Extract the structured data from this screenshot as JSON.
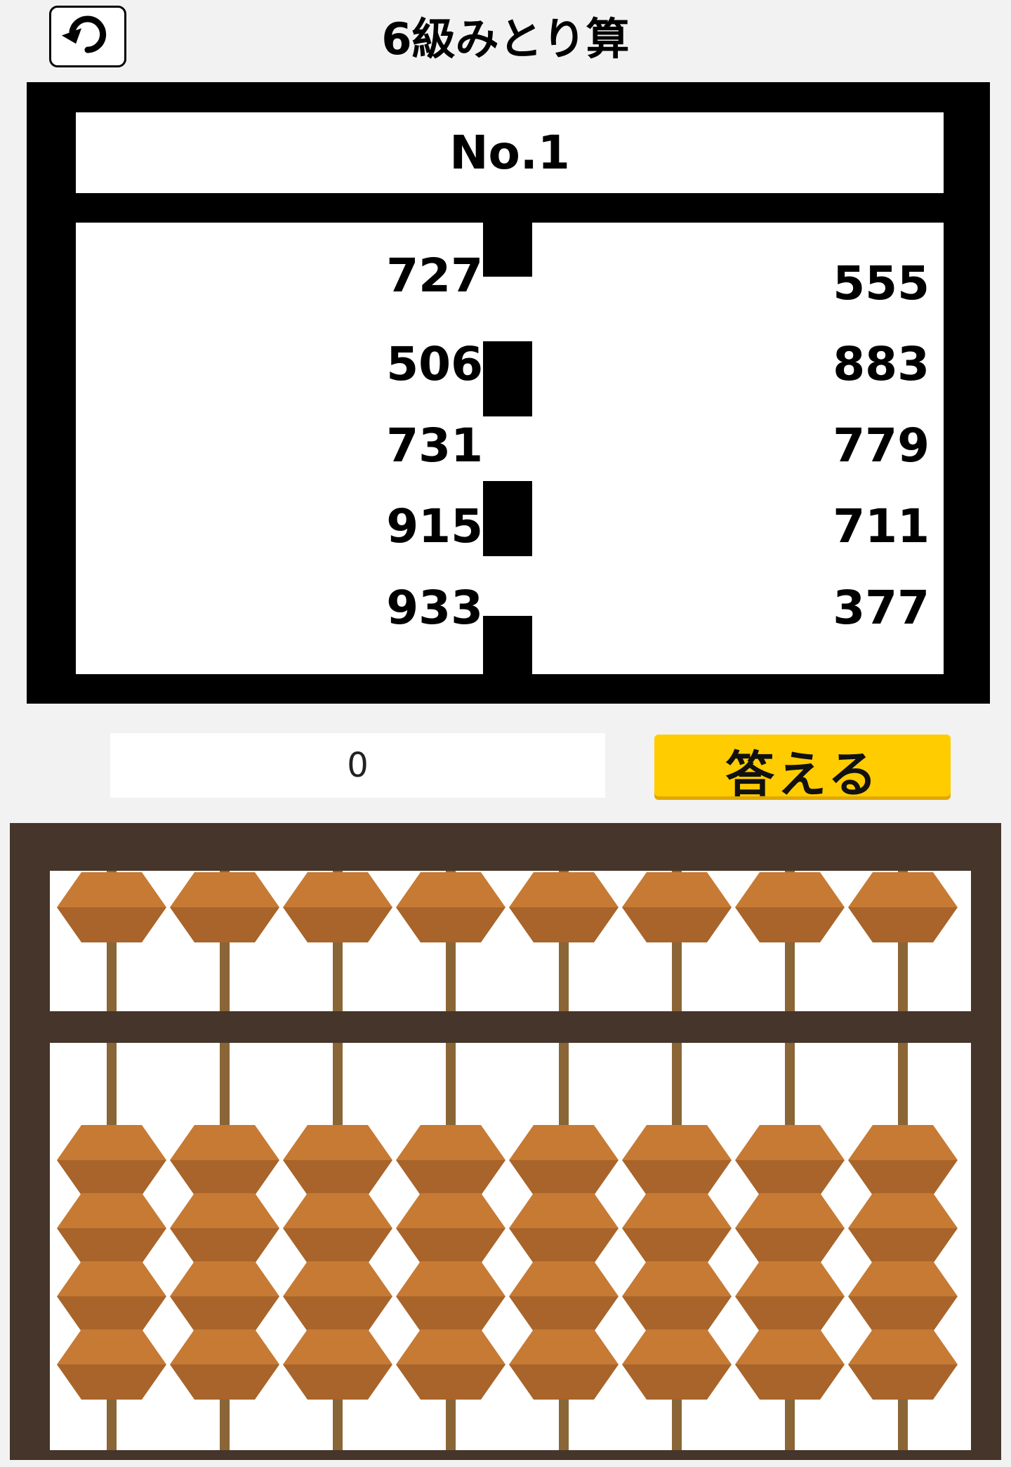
{
  "header": {
    "back_icon": "undo-arrow-icon",
    "title": "6級みとり算"
  },
  "problem": {
    "number_label": "No.1",
    "left_column": [
      "727",
      "506",
      "731",
      "915",
      "933"
    ],
    "right_column": [
      "555",
      "883",
      "779",
      "711",
      "377"
    ]
  },
  "answer": {
    "value": "0",
    "submit_label": "答える"
  },
  "abacus": {
    "rods": 8,
    "upper_beads_per_rod": 1,
    "lower_beads_per_rod": 4,
    "colors": {
      "frame": "#46352a",
      "bead_light": "#c67a34",
      "bead_dark": "#a8642a",
      "rod": "#8a6536"
    }
  }
}
